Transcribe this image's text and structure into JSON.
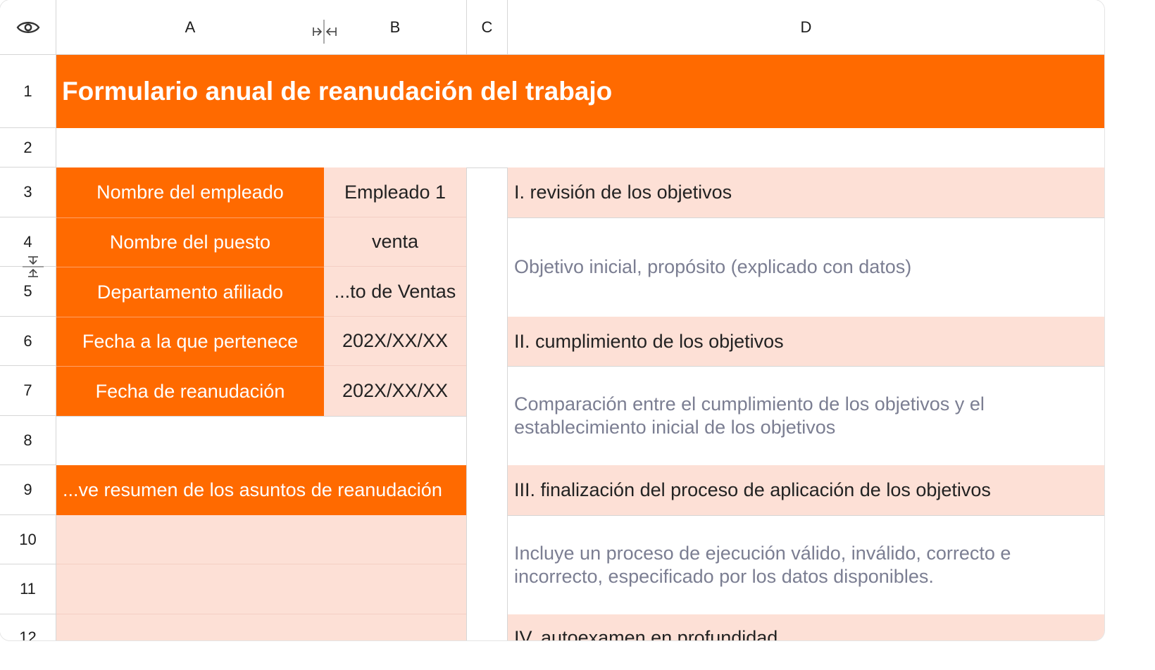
{
  "columns": [
    {
      "label": "A"
    },
    {
      "label": "B"
    },
    {
      "label": "C"
    },
    {
      "label": "D"
    }
  ],
  "rows": [
    "1",
    "2",
    "3",
    "4",
    "5",
    "6",
    "7",
    "8",
    "9",
    "10",
    "11",
    "12"
  ],
  "sheet": {
    "title": "Formulario anual de reanudación del trabajo",
    "fields": [
      {
        "label": "Nombre del empleado",
        "value": "Empleado 1"
      },
      {
        "label": "Nombre del puesto",
        "value": "venta"
      },
      {
        "label": "Departamento afiliado",
        "value": "...to de Ventas"
      },
      {
        "label": "Fecha a la que pertenece",
        "value": "202X/XX/XX"
      },
      {
        "label": "Fecha de reanudación",
        "value": "202X/XX/XX"
      }
    ],
    "summary_header": "...ve resumen de los asuntos de reanudación",
    "sections": [
      {
        "heading": "I. revisión de los objetivos",
        "description": "Objetivo inicial, propósito (explicado con datos)"
      },
      {
        "heading": "II. cumplimiento de los objetivos",
        "description": "Comparación entre el cumplimiento de los objetivos y el establecimiento inicial de los objetivos"
      },
      {
        "heading": "III. finalización del proceso de aplicación de los objetivos",
        "description": "Incluye un proceso de ejecución válido, inválido, correcto e incorrecto, especificado por los datos disponibles."
      },
      {
        "heading": "IV. autoexamen en profundidad"
      }
    ]
  },
  "icons": {
    "visibility": "eye-icon",
    "column_resize": "column-collapse-icon",
    "row_resize": "row-collapse-icon"
  },
  "colors": {
    "accent": "#ff6a00",
    "light_fill": "#fde0d6",
    "muted_text": "#7b7e92"
  }
}
